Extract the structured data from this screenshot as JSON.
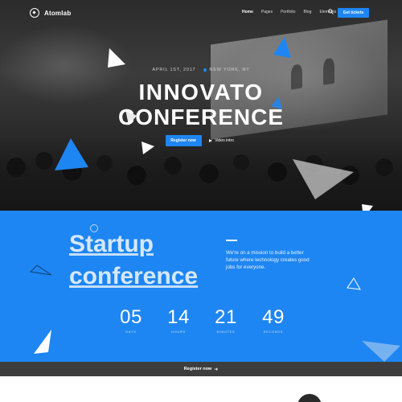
{
  "brand": {
    "name": "Atomlab"
  },
  "nav": {
    "items": [
      {
        "label": "Home",
        "active": true
      },
      {
        "label": "Pages",
        "active": false
      },
      {
        "label": "Portfolio",
        "active": false
      },
      {
        "label": "Blog",
        "active": false
      },
      {
        "label": "Elements",
        "active": false
      }
    ],
    "search_icon": "search-icon",
    "cta_label": "Get tickets"
  },
  "hero": {
    "date": "APRIL 1ST, 2017",
    "location": "NEW YORK, NY",
    "title_line1": "INNOVATO",
    "title_line2": "CONFERENCE",
    "register_label": "Register now",
    "video_label": "Video intro"
  },
  "about": {
    "title_line1": "Startup",
    "title_line2": "conference",
    "mission": "We're on a mission to build a better future where technology creates good jobs for everyone."
  },
  "countdown": [
    {
      "value": "05",
      "label": "DAYS"
    },
    {
      "value": "14",
      "label": "HOURS"
    },
    {
      "value": "21",
      "label": "MINUTES"
    },
    {
      "value": "49",
      "label": "SECONDS"
    }
  ],
  "register_bar": {
    "label": "Register now"
  },
  "colors": {
    "accent": "#1e86f2",
    "dark_bar": "#3d3d3d",
    "hero_bg": "#2b2b2b"
  }
}
